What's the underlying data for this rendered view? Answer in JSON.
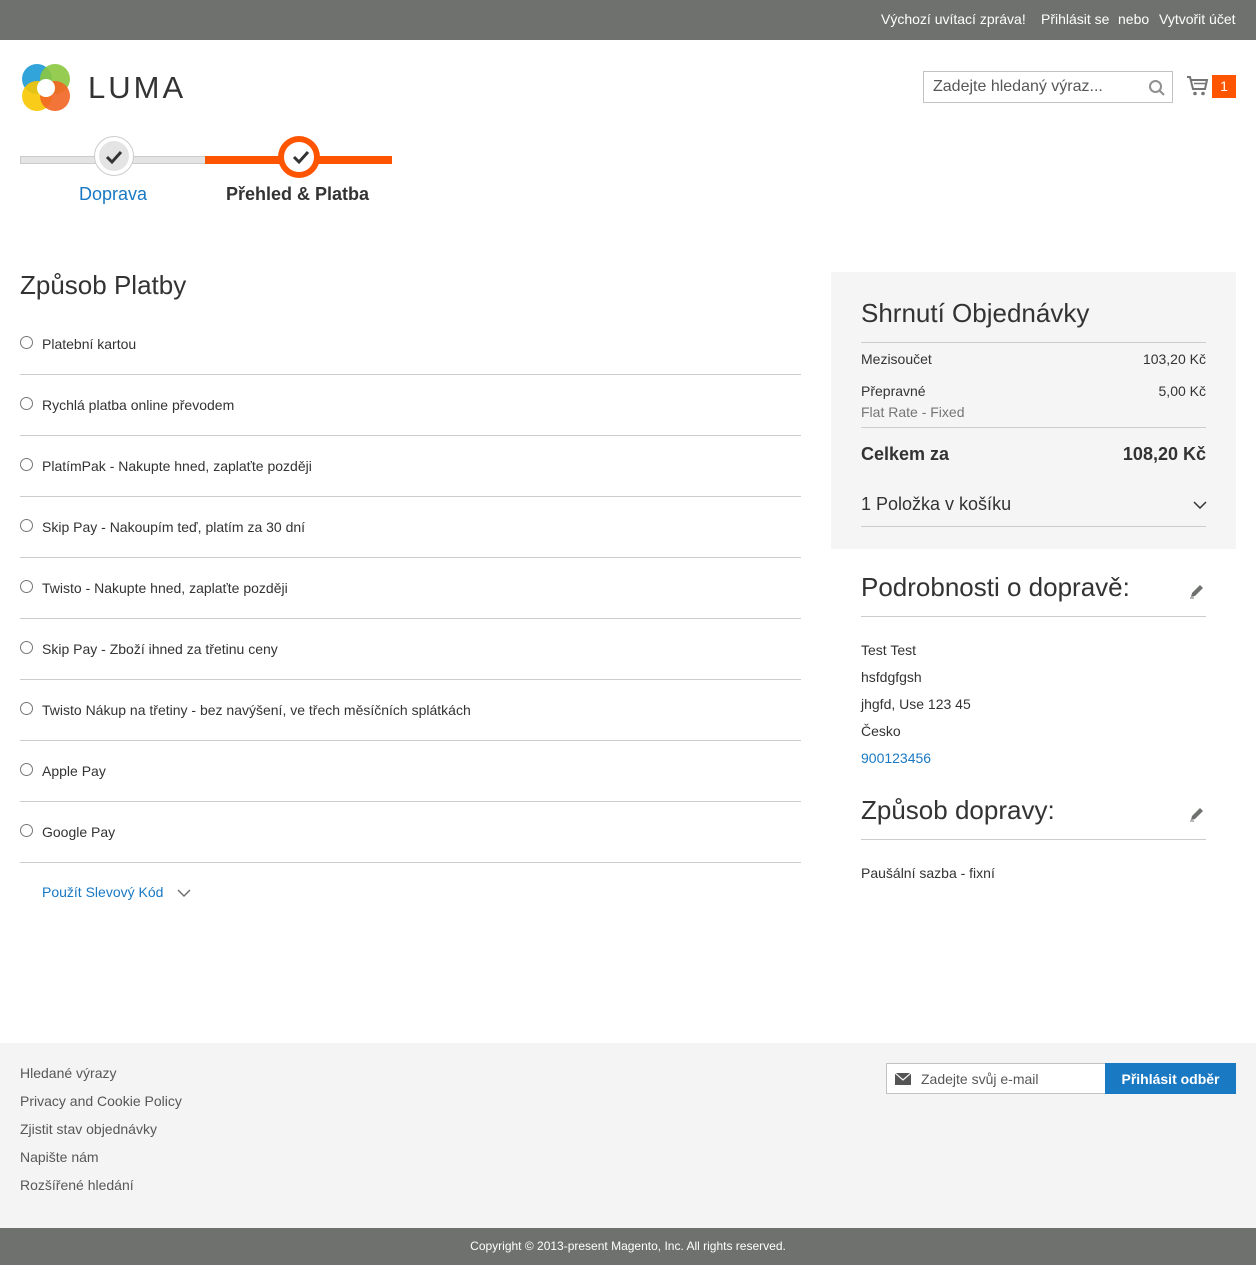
{
  "top_bar": {
    "welcome": "Výchozí uvítací zpráva!",
    "sign_in": "Přihlásit se",
    "or": "nebo",
    "create_account": "Vytvořit účet"
  },
  "header": {
    "logo_text": "LUMA",
    "search_placeholder": "Zadejte hledaný výraz...",
    "cart_count": "1",
    "colors": {
      "accent": "#ff5501",
      "link": "#1979c3"
    }
  },
  "progress": {
    "steps": [
      {
        "label": "Doprava",
        "state": "complete"
      },
      {
        "label": "Přehled & Platba",
        "state": "active"
      }
    ]
  },
  "payment": {
    "title": "Způsob Platby",
    "methods": [
      "Platební kartou",
      "Rychlá platba online převodem",
      "PlatímPak - Nakupte hned, zaplaťte později",
      "Skip Pay - Nakoupím teď, platím za 30 dní",
      "Twisto - Nakupte hned, zaplaťte později",
      "Skip Pay - Zboží ihned za třetinu ceny",
      "Twisto Nákup na třetiny - bez navýšení, ve třech měsíčních splátkách",
      "Apple Pay",
      "Google Pay"
    ],
    "discount_label": "Použít Slevový Kód"
  },
  "summary": {
    "title": "Shrnutí Objednávky",
    "subtotal_label": "Mezisoučet",
    "subtotal_value": "103,20 Kč",
    "shipping_label": "Přepravné",
    "shipping_value": "5,00 Kč",
    "shipping_method_note": "Flat Rate - Fixed",
    "total_label": "Celkem za",
    "total_value": "108,20 Kč",
    "items_label": "1 Položka v košíku"
  },
  "shipping_details": {
    "title": "Podrobnosti o dopravě:",
    "name": "Test Test",
    "street": "hsfdgfgsh",
    "city": "jhgfd, Use 123 45",
    "country": "Česko",
    "phone": "900123456"
  },
  "shipping_method": {
    "title": "Způsob dopravy:",
    "value": "Paušální sazba - fixní"
  },
  "footer": {
    "links": [
      "Hledané výrazy",
      "Privacy and Cookie Policy",
      "Zjistit stav objednávky",
      "Napište nám",
      "Rozšířené hledání"
    ],
    "newsletter_placeholder": "Zadejte svůj e-mail",
    "newsletter_button": "Přihlásit odběr",
    "copyright": "Copyright © 2013-present Magento, Inc. All rights reserved."
  }
}
